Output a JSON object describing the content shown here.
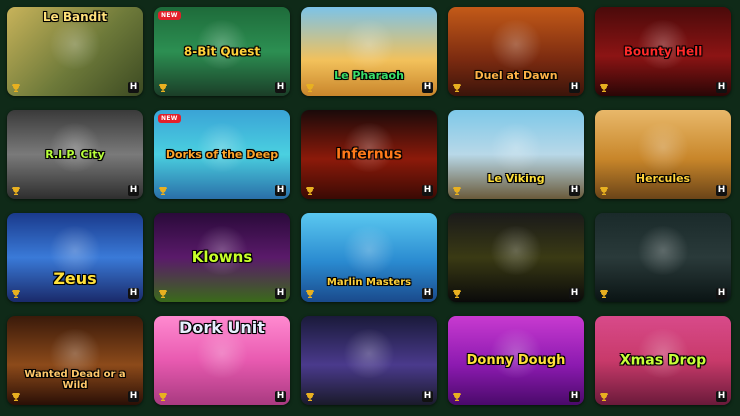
{
  "games": [
    {
      "title": "Le Bandit",
      "is_new": false,
      "bg": "linear-gradient(135deg,#c8b35a,#6e7a3a 55%,#3c4a22)",
      "title_color": "#ffe07a",
      "title_size": "12px",
      "title_pos": "top"
    },
    {
      "title": "8-Bit Quest",
      "is_new": true,
      "bg": "linear-gradient(180deg,#1e6b3a,#2c8f52 50%,#1b3e28)",
      "title_color": "#ffd23a",
      "title_size": "12px",
      "title_pos": "mid"
    },
    {
      "title": "Le Pharaoh",
      "is_new": false,
      "bg": "linear-gradient(180deg,#7cc3e8,#f2c15b 60%,#c9852b)",
      "title_color": "#3adf6a",
      "title_size": "11px",
      "title_pos": "bottom"
    },
    {
      "title": "Duel at Dawn",
      "is_new": false,
      "bg": "linear-gradient(180deg,#c35a18,#7a2a10 60%,#3b140a)",
      "title_color": "#ffb347",
      "title_size": "11px",
      "title_pos": "bottom"
    },
    {
      "title": "Bounty Hell",
      "is_new": false,
      "bg": "linear-gradient(180deg,#4a0a0a,#8c1414 55%,#2a0606)",
      "title_color": "#ff2a2a",
      "title_size": "12px",
      "title_pos": "mid"
    },
    {
      "title": "R.I.P. City",
      "is_new": false,
      "bg": "linear-gradient(180deg,#3a3a3a,#7a7a7a 50%,#2e2e2e)",
      "title_color": "#b8ff3a",
      "title_size": "11px",
      "title_pos": "mid"
    },
    {
      "title": "Dorks of the Deep",
      "is_new": true,
      "bg": "linear-gradient(180deg,#3aa3d6,#4ad0e0 50%,#2a6fa8)",
      "title_color": "#ffa52a",
      "title_size": "11px",
      "title_pos": "mid"
    },
    {
      "title": "Infernus",
      "is_new": false,
      "bg": "linear-gradient(180deg,#1a0a0a,#8c1a0a 55%,#3a0a04)",
      "title_color": "#ff7a1a",
      "title_size": "14px",
      "title_pos": "mid"
    },
    {
      "title": "Le Viking",
      "is_new": false,
      "bg": "linear-gradient(180deg,#7ec8e8,#b8d8e8 50%,#6a5a3a)",
      "title_color": "#ffe03a",
      "title_size": "11px",
      "title_pos": "bottom"
    },
    {
      "title": "Hercules",
      "is_new": false,
      "bg": "linear-gradient(180deg,#e8b86a,#c8862a 55%,#6a4418)",
      "title_color": "#ffd23a",
      "title_size": "11px",
      "title_pos": "bottom"
    },
    {
      "title": "Zeus",
      "is_new": false,
      "bg": "linear-gradient(180deg,#1a3a8c,#3a7ad8 50%,#1a2a6a)",
      "title_color": "#ffe03a",
      "title_size": "16px",
      "title_pos": "bottom"
    },
    {
      "title": "Klowns",
      "is_new": false,
      "bg": "linear-gradient(180deg,#2a0a3a,#5a1a6a 50%,#3a6a1a)",
      "title_color": "#c8ff2a",
      "title_size": "15px",
      "title_pos": "mid"
    },
    {
      "title": "Marlin Masters",
      "is_new": false,
      "bg": "linear-gradient(180deg,#5ac8f0,#2a8ad0 55%,#1a4a8c)",
      "title_color": "#ffd23a",
      "title_size": "10px",
      "title_pos": "bottom"
    },
    {
      "title": "",
      "is_new": false,
      "bg": "linear-gradient(180deg,#1a1a1a,#3a3a14 50%,#0a0a0a)",
      "title_color": "#c8ff2a",
      "title_size": "11px",
      "title_pos": "mid"
    },
    {
      "title": "",
      "is_new": false,
      "bg": "linear-gradient(180deg,#1a2a2a,#2a3a3a 50%,#0a1414)",
      "title_color": "#3ae0c8",
      "title_size": "11px",
      "title_pos": "mid"
    },
    {
      "title": "Wanted Dead or a Wild",
      "is_new": false,
      "bg": "linear-gradient(180deg,#3a1a0a,#8c4a1a 55%,#2a0f06)",
      "title_color": "#ffc86a",
      "title_size": "10px",
      "title_pos": "bottom"
    },
    {
      "title": "Dork Unit",
      "is_new": false,
      "bg": "linear-gradient(180deg,#ff8ad0,#e85ab0 50%,#a83a80)",
      "title_color": "#e8f0ff",
      "title_size": "16px",
      "title_pos": "top"
    },
    {
      "title": "",
      "is_new": false,
      "bg": "linear-gradient(180deg,#1a1a3a,#4a3a8c 55%,#1a1a2a)",
      "title_color": "#3ac8ff",
      "title_size": "11px",
      "title_pos": "top"
    },
    {
      "title": "Donny Dough",
      "is_new": false,
      "bg": "linear-gradient(180deg,#c83ad0,#8c1ab0 55%,#4a0a6a)",
      "title_color": "#ffe03a",
      "title_size": "13px",
      "title_pos": "mid"
    },
    {
      "title": "Xmas Drop",
      "is_new": false,
      "bg": "linear-gradient(180deg,#d84a8a,#c83a6a 50%,#6a1a3a)",
      "title_color": "#c8ff3a",
      "title_size": "14px",
      "title_pos": "mid"
    }
  ],
  "labels": {
    "new": "NEW",
    "provider": "H"
  },
  "colors": {
    "page_bg": "#0f2a18",
    "new_badge": "#e3202a",
    "trophy": "#e8b020"
  }
}
